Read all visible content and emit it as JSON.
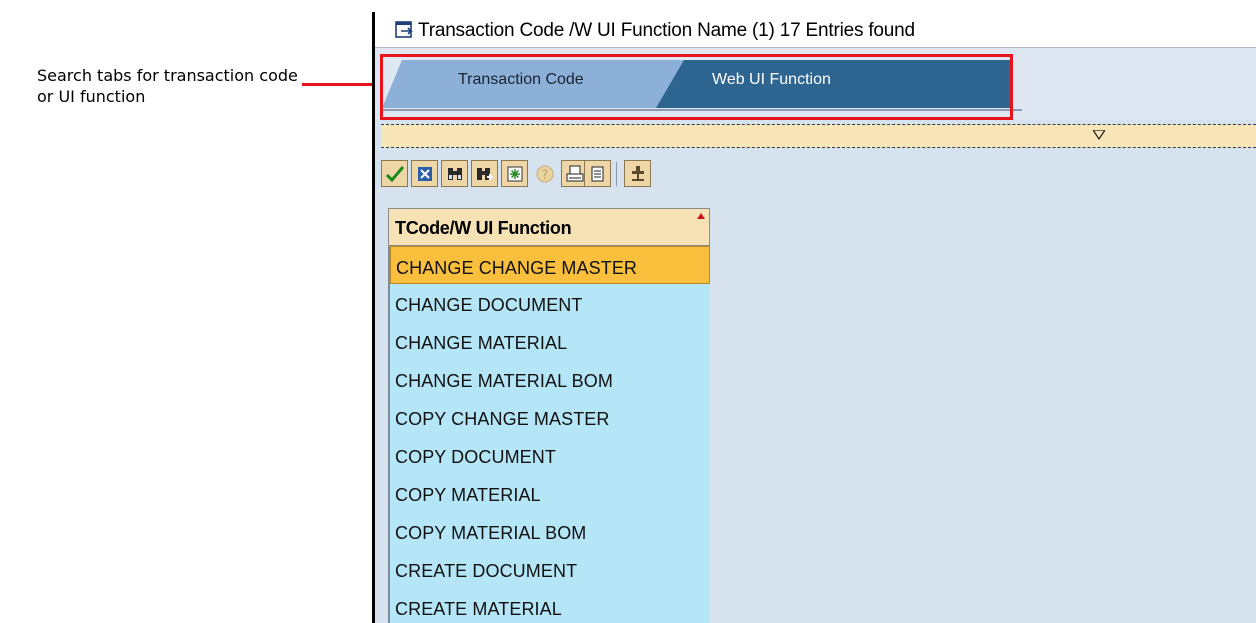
{
  "annotation": {
    "text": "Search tabs for transaction code or UI function"
  },
  "window": {
    "title": "Transaction Code /W UI Function Name (1)   17 Entries found"
  },
  "tabs": [
    {
      "label": "Transaction Code",
      "active": false
    },
    {
      "label": "Web UI Function",
      "active": true
    }
  ],
  "toolbar": {
    "buttons": [
      "check-icon",
      "cancel-icon",
      "find-icon",
      "find-next-icon",
      "new-entries-icon",
      "help-icon",
      "print-icon",
      "list-icon",
      "filter-icon"
    ]
  },
  "grid": {
    "column_header": "TCode/W UI Function",
    "rows": [
      "CHANGE CHANGE MASTER",
      "CHANGE DOCUMENT",
      "CHANGE MATERIAL",
      "CHANGE MATERIAL BOM",
      "COPY CHANGE MASTER",
      "COPY DOCUMENT",
      "COPY MATERIAL",
      "COPY MATERIAL BOM",
      "CREATE DOCUMENT",
      "CREATE MATERIAL"
    ],
    "selected_index": 0
  },
  "colors": {
    "accent_red": "#e8141c",
    "active_tab": "#2e6590",
    "inactive_tab": "#8cb0d8",
    "selected_row": "#fabf3c",
    "row_bg": "#b4e6f7"
  }
}
